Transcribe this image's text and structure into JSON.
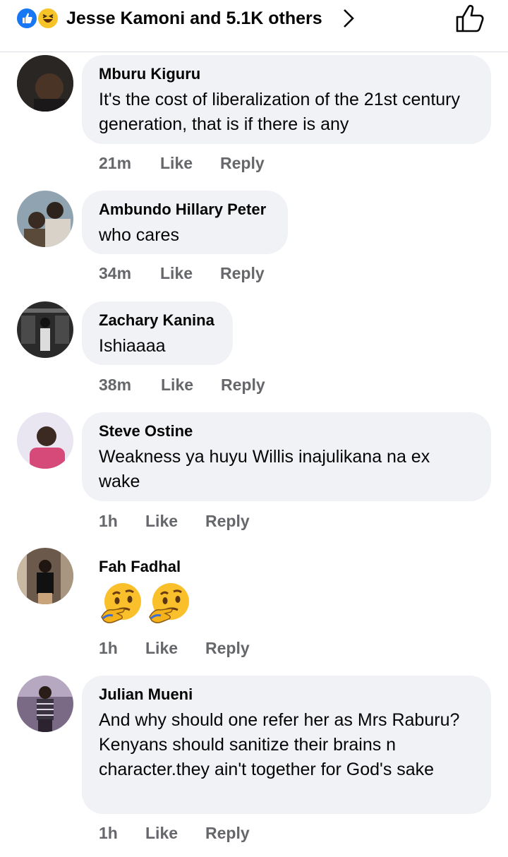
{
  "reactions": {
    "summary": "Jesse Kamoni and 5.1K others",
    "icons": [
      "like-reaction-icon",
      "haha-reaction-icon"
    ],
    "colors": {
      "like": "#1877f2",
      "haha": "#f7c428"
    }
  },
  "comments": [
    {
      "author": "Mburu Kiguru",
      "text": "It's the cost of liberalization of the 21st century generation, that is if there is any",
      "time": "21m",
      "like": "Like",
      "reply": "Reply"
    },
    {
      "author": "Ambundo Hillary Peter",
      "text": "who cares",
      "time": "34m",
      "like": "Like",
      "reply": "Reply"
    },
    {
      "author": "Zachary Kanina",
      "text": "Ishiaaaa",
      "time": "38m",
      "like": "Like",
      "reply": "Reply"
    },
    {
      "author": "Steve Ostine",
      "text": "Weakness ya huyu Willis inajulikana na ex wake",
      "time": "1h",
      "like": "Like",
      "reply": "Reply"
    },
    {
      "author": "Fah Fadhal",
      "emojis": [
        "thinking-face-emoji",
        "thinking-face-emoji"
      ],
      "time": "1h",
      "like": "Like",
      "reply": "Reply"
    },
    {
      "author": "Julian Mueni",
      "text": "And why should one refer her as Mrs Raburu? Kenyans should sanitize their brains n character.they ain't together for God's sake",
      "time": "1h",
      "like": "Like",
      "reply": "Reply"
    }
  ]
}
